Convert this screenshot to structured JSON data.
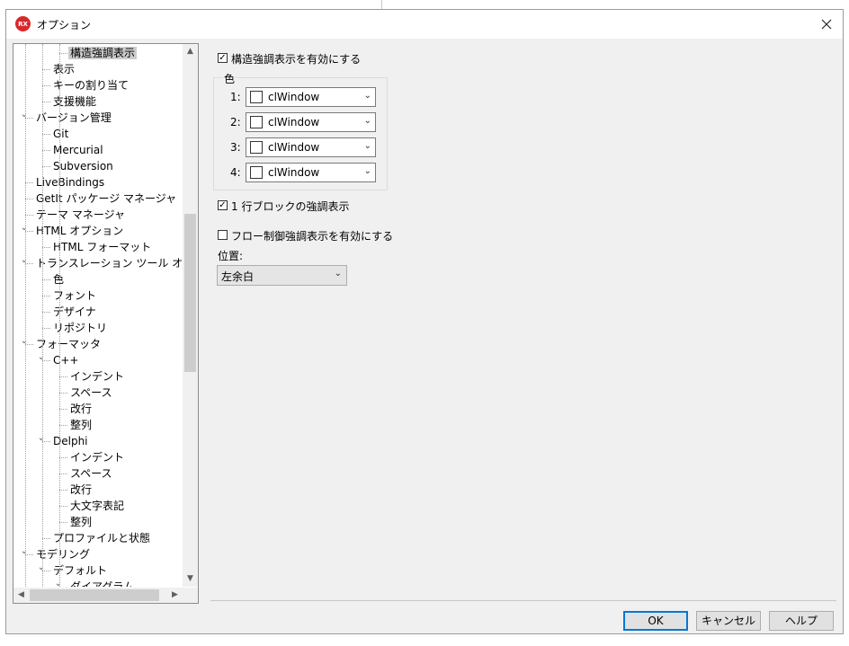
{
  "window": {
    "title": "オプション",
    "app_icon_text": "RX"
  },
  "tree": {
    "items": [
      {
        "label": "構造強調表示",
        "level": 3,
        "selected": true
      },
      {
        "label": "表示",
        "level": 2
      },
      {
        "label": "キーの割り当て",
        "level": 2
      },
      {
        "label": "支援機能",
        "level": 2
      },
      {
        "label": "バージョン管理",
        "level": 1,
        "expanded": true
      },
      {
        "label": "Git",
        "level": 2
      },
      {
        "label": "Mercurial",
        "level": 2
      },
      {
        "label": "Subversion",
        "level": 2
      },
      {
        "label": "LiveBindings",
        "level": 1
      },
      {
        "label": "GetIt パッケージ マネージャ",
        "level": 1
      },
      {
        "label": "テーマ マネージャ",
        "level": 1
      },
      {
        "label": "HTML オプション",
        "level": 1,
        "expanded": true
      },
      {
        "label": "HTML フォーマット",
        "level": 2
      },
      {
        "label": "トランスレーション ツール オプショ",
        "level": 1,
        "expanded": true
      },
      {
        "label": "色",
        "level": 2
      },
      {
        "label": "フォント",
        "level": 2
      },
      {
        "label": "デザイナ",
        "level": 2
      },
      {
        "label": "リポジトリ",
        "level": 2
      },
      {
        "label": "フォーマッタ",
        "level": 1,
        "expanded": true
      },
      {
        "label": "C++",
        "level": 2,
        "expanded": true
      },
      {
        "label": "インデント",
        "level": 3
      },
      {
        "label": "スペース",
        "level": 3
      },
      {
        "label": "改行",
        "level": 3
      },
      {
        "label": "整列",
        "level": 3
      },
      {
        "label": "Delphi",
        "level": 2,
        "expanded": true
      },
      {
        "label": "インデント",
        "level": 3
      },
      {
        "label": "スペース",
        "level": 3
      },
      {
        "label": "改行",
        "level": 3
      },
      {
        "label": "大文字表記",
        "level": 3
      },
      {
        "label": "整列",
        "level": 3
      },
      {
        "label": "プロファイルと状態",
        "level": 2
      },
      {
        "label": "モデリング",
        "level": 1,
        "expanded": true
      },
      {
        "label": "デフォルト",
        "level": 2,
        "expanded": true
      },
      {
        "label": "ダイアグラム",
        "level": 3,
        "expanded": true
      }
    ]
  },
  "settings": {
    "enable_structural_highlighting": {
      "label": "構造強調表示を有効にする",
      "checked": true
    },
    "colors_group_label": "色",
    "color_rows": [
      {
        "index": "1:",
        "value": "clWindow"
      },
      {
        "index": "2:",
        "value": "clWindow"
      },
      {
        "index": "3:",
        "value": "clWindow"
      },
      {
        "index": "4:",
        "value": "clWindow"
      }
    ],
    "single_line_block": {
      "label": "1 行ブロックの強調表示",
      "checked": true
    },
    "flow_control": {
      "label": "フロー制御強調表示を有効にする",
      "checked": false
    },
    "position_label": "位置:",
    "position_value": "左余白"
  },
  "buttons": {
    "ok": "OK",
    "cancel": "キャンセル",
    "help": "ヘルプ"
  }
}
